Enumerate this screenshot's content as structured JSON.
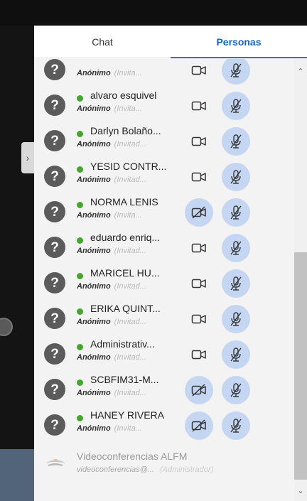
{
  "tabs": [
    {
      "label": "Chat",
      "active": false
    },
    {
      "label": "Personas",
      "active": true
    }
  ],
  "participants": [
    {
      "name": "",
      "role": "Anónimo",
      "note": "(Invita...",
      "camera_off": false
    },
    {
      "name": "alvaro esquivel",
      "role": "Anónimo",
      "note": "(Invita...",
      "camera_off": false
    },
    {
      "name": "Darlyn Bolaño...",
      "role": "Anónimo",
      "note": "(Invitad...",
      "camera_off": false
    },
    {
      "name": "YESID CONTR...",
      "role": "Anónimo",
      "note": "(Invitad...",
      "camera_off": false
    },
    {
      "name": "NORMA LENIS",
      "role": "Anónimo",
      "note": "(Invita...",
      "camera_off": true
    },
    {
      "name": "eduardo enriq...",
      "role": "Anónimo",
      "note": "(Invitad...",
      "camera_off": false
    },
    {
      "name": "MARICEL HU...",
      "role": "Anónimo",
      "note": "(Invitad...",
      "camera_off": false
    },
    {
      "name": "ERIKA QUINT...",
      "role": "Anónimo",
      "note": "(Invitad...",
      "camera_off": false
    },
    {
      "name": "Administrativ...",
      "role": "Anónimo",
      "note": "(Invitad...",
      "camera_off": false
    },
    {
      "name": "SCBFIM31-M...",
      "role": "Anónimo",
      "note": "(Invitad...",
      "camera_off": true
    },
    {
      "name": "HANEY RIVERA",
      "role": "Anónimo",
      "note": "(Invita...",
      "camera_off": true
    }
  ],
  "admin": {
    "name": "Videoconferencias ALFM",
    "email": "videoconferencias@...",
    "role": "(Administrador)"
  },
  "icons": {
    "avatar": "question-mark-avatar-icon",
    "status": "online-dot-icon",
    "camera": "video-camera-icon",
    "camera_off": "video-camera-off-icon",
    "mic_off": "microphone-muted-icon",
    "scroll_up": "chevron-up-icon",
    "scroll_down": "chevron-down-icon",
    "panel_toggle": "chevron-right-icon"
  },
  "colors": {
    "accent": "#1a5fd0",
    "online": "#45a62e",
    "button_bg": "#c4d6f2"
  }
}
